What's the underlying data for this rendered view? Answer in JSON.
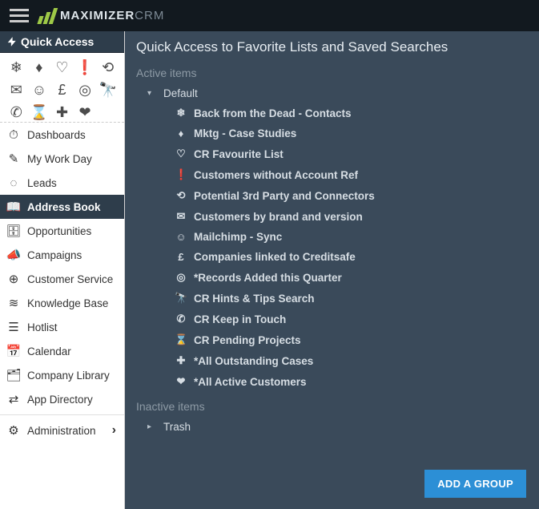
{
  "brand": {
    "name_a": "MAXIMIZER",
    "name_b": "CRM"
  },
  "quick_access": {
    "header": "Quick Access"
  },
  "icon_grid": [
    {
      "name": "snowflake-icon",
      "glyph": "❄"
    },
    {
      "name": "diamond-icon",
      "glyph": "♦"
    },
    {
      "name": "heart-outline-icon",
      "glyph": "♡"
    },
    {
      "name": "alert-icon",
      "glyph": "❗"
    },
    {
      "name": "refresh-icon",
      "glyph": "⟲"
    },
    {
      "name": "envelope-icon",
      "glyph": "✉"
    },
    {
      "name": "octocat-icon",
      "glyph": "☺"
    },
    {
      "name": "pound-icon",
      "glyph": "£"
    },
    {
      "name": "tripadvisor-icon",
      "glyph": "◎"
    },
    {
      "name": "binoculars-icon",
      "glyph": "🔭"
    },
    {
      "name": "phone-icon",
      "glyph": "✆"
    },
    {
      "name": "hourglass-icon",
      "glyph": "⌛"
    },
    {
      "name": "plus-box-icon",
      "glyph": "✚"
    },
    {
      "name": "heart-solid-icon",
      "glyph": "❤"
    }
  ],
  "nav": [
    {
      "id": "dashboards",
      "label": "Dashboards",
      "glyph": "⏱",
      "active": false
    },
    {
      "id": "my-work-day",
      "label": "My Work Day",
      "glyph": "✎",
      "active": false
    },
    {
      "id": "leads",
      "label": "Leads",
      "glyph": "◌",
      "active": false
    },
    {
      "id": "address-book",
      "label": "Address Book",
      "glyph": "📖",
      "active": true
    },
    {
      "id": "opportunities",
      "label": "Opportunities",
      "glyph": "🗄",
      "active": false
    },
    {
      "id": "campaigns",
      "label": "Campaigns",
      "glyph": "📣",
      "active": false
    },
    {
      "id": "customer-service",
      "label": "Customer Service",
      "glyph": "⊕",
      "active": false
    },
    {
      "id": "knowledge-base",
      "label": "Knowledge Base",
      "glyph": "≋",
      "active": false
    },
    {
      "id": "hotlist",
      "label": "Hotlist",
      "glyph": "☰",
      "active": false
    },
    {
      "id": "calendar",
      "label": "Calendar",
      "glyph": "📅",
      "active": false
    },
    {
      "id": "company-library",
      "label": "Company Library",
      "glyph": "🗂",
      "active": false
    },
    {
      "id": "app-directory",
      "label": "App Directory",
      "glyph": "⇄",
      "active": false
    }
  ],
  "nav_footer": {
    "id": "administration",
    "label": "Administration",
    "glyph": "⚙"
  },
  "panel": {
    "title": "Quick Access to Favorite Lists and Saved Searches",
    "active_label": "Active items",
    "inactive_label": "Inactive items",
    "default_folder": "Default",
    "trash_folder": "Trash",
    "add_group_button": "ADD A GROUP",
    "items": [
      {
        "glyph": "❄",
        "icon_name": "snowflake-icon",
        "label": "Back from the Dead - Contacts"
      },
      {
        "glyph": "♦",
        "icon_name": "diamond-icon",
        "label": "Mktg - Case Studies"
      },
      {
        "glyph": "♡",
        "icon_name": "heart-outline-icon",
        "label": "CR Favourite List"
      },
      {
        "glyph": "❗",
        "icon_name": "alert-icon",
        "label": "Customers without Account Ref"
      },
      {
        "glyph": "⟲",
        "icon_name": "refresh-icon",
        "label": "Potential 3rd Party and Connectors"
      },
      {
        "glyph": "✉",
        "icon_name": "envelope-icon",
        "label": "Customers by brand and version"
      },
      {
        "glyph": "☺",
        "icon_name": "octocat-icon",
        "label": "Mailchimp - Sync"
      },
      {
        "glyph": "£",
        "icon_name": "pound-icon",
        "label": "Companies linked to Creditsafe"
      },
      {
        "glyph": "◎",
        "icon_name": "tripadvisor-icon",
        "label": "*Records Added this Quarter"
      },
      {
        "glyph": "🔭",
        "icon_name": "binoculars-icon",
        "label": "CR Hints & Tips Search"
      },
      {
        "glyph": "✆",
        "icon_name": "phone-icon",
        "label": "CR Keep in Touch"
      },
      {
        "glyph": "⌛",
        "icon_name": "hourglass-icon",
        "label": "CR Pending Projects"
      },
      {
        "glyph": "✚",
        "icon_name": "plus-box-icon",
        "label": "*All Outstanding Cases"
      },
      {
        "glyph": "❤",
        "icon_name": "heart-solid-icon",
        "label": "*All Active Customers"
      }
    ]
  }
}
